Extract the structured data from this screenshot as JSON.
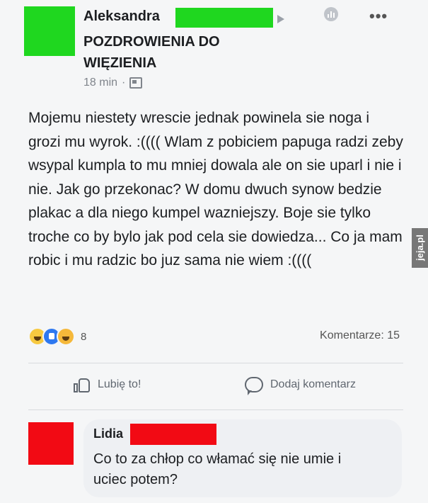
{
  "post": {
    "author": "Aleksandra",
    "group": "POZDROWIENIA DO WIĘZIENIA",
    "time": "18 min",
    "meta_separator": "·",
    "menu_icon": "more-horizontal-icon",
    "text": "Mojemu niestety wrescie jednak powinela sie noga i grozi mu wyrok. :(((( Wlam z pobiciem papuga radzi zeby wsypal kumpla to mu mniej dowala ale on sie uparl i nie i nie. Jak go przekonac? W domu dwuch synow bedzie plakac a dla niego kumpel wazniejszy. Boje sie tylko troche co by bylo jak pod cela sie dowiedza... Co ja mam robic i mu radzic bo juz sama nie wiem :((((",
    "reaction_count": "8",
    "comments_label": "Komentarze: 15"
  },
  "actions": {
    "like_label": "Lubię to!",
    "comment_label": "Dodaj komentarz"
  },
  "comment": {
    "author": "Lidia",
    "text": "Co to za chłop co włamać się nie umie i uciec potem?"
  },
  "watermark": "jeja.pl",
  "colors": {
    "redaction_green": "#1fd71f",
    "redaction_red": "#f20a14"
  }
}
